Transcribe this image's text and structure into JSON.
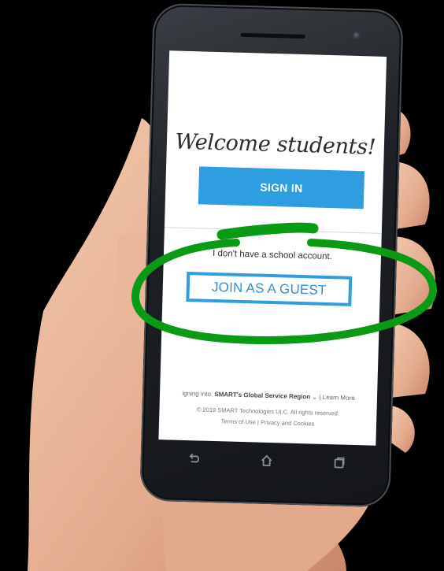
{
  "screen": {
    "welcome_title": "Welcome students!",
    "signin_label": "SIGN IN",
    "no_account_text": "I don't have a school account.",
    "guest_label": "JOIN AS A GUEST",
    "footer": {
      "signing_prefix": "igning into:",
      "region_name": "SMART's Global Service Region",
      "region_chevron": "⌄",
      "separator": "|",
      "learn_more": "Learn More",
      "copyright": "© 2019 SMART Technologies ULC. All rights reserved.",
      "terms": "Terms of Use",
      "privacy": "Privacy and Cookies"
    }
  },
  "nav": {
    "back_icon": "back-icon",
    "home_icon": "home-icon",
    "recents_icon": "recents-icon"
  },
  "colors": {
    "accent_blue": "#2f9ee0",
    "annotation_green": "#0a9a16",
    "phone_body": "#1d2024"
  }
}
